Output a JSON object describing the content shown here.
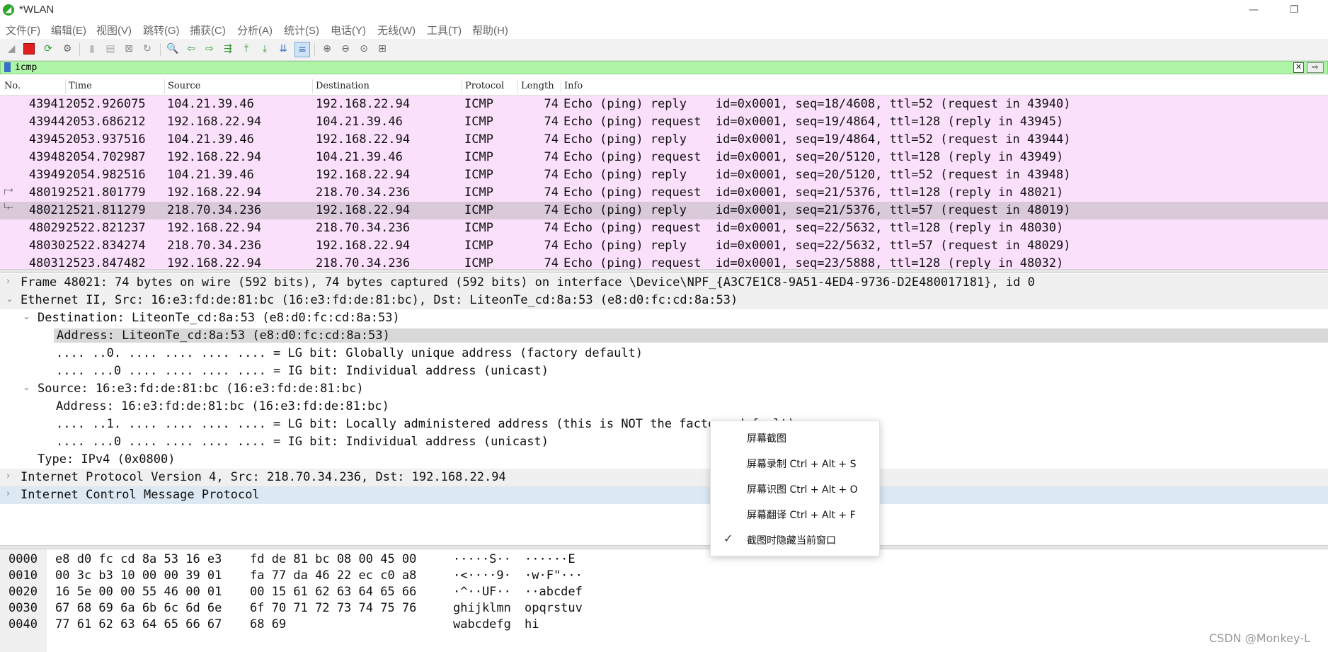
{
  "window": {
    "title": "*WLAN",
    "app_icon": "wireshark-fin-icon"
  },
  "menubar": [
    "文件(F)",
    "编辑(E)",
    "视图(V)",
    "跳转(G)",
    "捕获(C)",
    "分析(A)",
    "统计(S)",
    "电话(Y)",
    "无线(W)",
    "工具(T)",
    "帮助(H)"
  ],
  "filter": {
    "value": "icmp"
  },
  "packet_columns": [
    "No.",
    "Time",
    "Source",
    "Destination",
    "Protocol",
    "Length",
    "Info"
  ],
  "packets": [
    {
      "no": "43941",
      "time": "2052.926075",
      "src": "104.21.39.46",
      "dst": "192.168.22.94",
      "proto": "ICMP",
      "len": "74",
      "info": "Echo (ping) reply    id=0x0001, seq=18/4608, ttl=52 (request in 43940)"
    },
    {
      "no": "43944",
      "time": "2053.686212",
      "src": "192.168.22.94",
      "dst": "104.21.39.46",
      "proto": "ICMP",
      "len": "74",
      "info": "Echo (ping) request  id=0x0001, seq=19/4864, ttl=128 (reply in 43945)"
    },
    {
      "no": "43945",
      "time": "2053.937516",
      "src": "104.21.39.46",
      "dst": "192.168.22.94",
      "proto": "ICMP",
      "len": "74",
      "info": "Echo (ping) reply    id=0x0001, seq=19/4864, ttl=52 (request in 43944)"
    },
    {
      "no": "43948",
      "time": "2054.702987",
      "src": "192.168.22.94",
      "dst": "104.21.39.46",
      "proto": "ICMP",
      "len": "74",
      "info": "Echo (ping) request  id=0x0001, seq=20/5120, ttl=128 (reply in 43949)"
    },
    {
      "no": "43949",
      "time": "2054.982516",
      "src": "104.21.39.46",
      "dst": "192.168.22.94",
      "proto": "ICMP",
      "len": "74",
      "info": "Echo (ping) reply    id=0x0001, seq=20/5120, ttl=52 (request in 43948)"
    },
    {
      "no": "48019",
      "time": "2521.801779",
      "src": "192.168.22.94",
      "dst": "218.70.34.236",
      "proto": "ICMP",
      "len": "74",
      "info": "Echo (ping) request  id=0x0001, seq=21/5376, ttl=128 (reply in 48021)"
    },
    {
      "no": "48021",
      "time": "2521.811279",
      "src": "218.70.34.236",
      "dst": "192.168.22.94",
      "proto": "ICMP",
      "len": "74",
      "info": "Echo (ping) reply    id=0x0001, seq=21/5376, ttl=57 (request in 48019)"
    },
    {
      "no": "48029",
      "time": "2522.821237",
      "src": "192.168.22.94",
      "dst": "218.70.34.236",
      "proto": "ICMP",
      "len": "74",
      "info": "Echo (ping) request  id=0x0001, seq=22/5632, ttl=128 (reply in 48030)"
    },
    {
      "no": "48030",
      "time": "2522.834274",
      "src": "218.70.34.236",
      "dst": "192.168.22.94",
      "proto": "ICMP",
      "len": "74",
      "info": "Echo (ping) reply    id=0x0001, seq=22/5632, ttl=57 (request in 48029)"
    },
    {
      "no": "48031",
      "time": "2523.847482",
      "src": "192.168.22.94",
      "dst": "218.70.34.236",
      "proto": "ICMP",
      "len": "74",
      "info": "Echo (ping) request  id=0x0001, seq=23/5888, ttl=128 (reply in 48032)"
    }
  ],
  "details": [
    "Frame 48021: 74 bytes on wire (592 bits), 74 bytes captured (592 bits) on interface \\Device\\NPF_{A3C7E1C8-9A51-4ED4-9736-D2E480017181}, id 0",
    "Ethernet II, Src: 16:e3:fd:de:81:bc (16:e3:fd:de:81:bc), Dst: LiteonTe_cd:8a:53 (e8:d0:fc:cd:8a:53)",
    "Destination: LiteonTe_cd:8a:53 (e8:d0:fc:cd:8a:53)",
    "Address: LiteonTe_cd:8a:53 (e8:d0:fc:cd:8a:53)",
    ".... ..0. .... .... .... .... = LG bit: Globally unique address (factory default)",
    ".... ...0 .... .... .... .... = IG bit: Individual address (unicast)",
    "Source: 16:e3:fd:de:81:bc (16:e3:fd:de:81:bc)",
    "Address: 16:e3:fd:de:81:bc (16:e3:fd:de:81:bc)",
    ".... ..1. .... .... .... .... = LG bit: Locally administered address (this is NOT the factory default)",
    ".... ...0 .... .... .... .... = IG bit: Individual address (unicast)",
    "Type: IPv4 (0x0800)",
    "Internet Protocol Version 4, Src: 218.70.34.236, Dst: 192.168.22.94",
    "Internet Control Message Protocol"
  ],
  "hex": [
    {
      "off": "0000",
      "b1": "e8 d0 fc cd 8a 53 16 e3",
      "b2": "fd de 81 bc 08 00 45 00",
      "a1": "·····S··",
      "a2": "······E"
    },
    {
      "off": "0010",
      "b1": "00 3c b3 10 00 00 39 01",
      "b2": "fa 77 da 46 22 ec c0 a8",
      "a1": "·<····9·",
      "a2": "·w·F\"···"
    },
    {
      "off": "0020",
      "b1": "16 5e 00 00 55 46 00 01",
      "b2": "00 15 61 62 63 64 65 66",
      "a1": "·^··UF··",
      "a2": "··abcdef"
    },
    {
      "off": "0030",
      "b1": "67 68 69 6a 6b 6c 6d 6e",
      "b2": "6f 70 71 72 73 74 75 76",
      "a1": "ghijklmn",
      "a2": "opqrstuv"
    },
    {
      "off": "0040",
      "b1": "77 61 62 63 64 65 66 67",
      "b2": "68 69",
      "a1": "wabcdefg",
      "a2": "hi"
    }
  ],
  "context_menu": [
    {
      "label": "屏幕截图",
      "checked": false
    },
    {
      "label": "屏幕录制 Ctrl + Alt + S",
      "checked": false
    },
    {
      "label": "屏幕识图 Ctrl + Alt + O",
      "checked": false
    },
    {
      "label": "屏幕翻译 Ctrl + Alt + F",
      "checked": false
    },
    {
      "label": "截图时隐藏当前窗口",
      "checked": true
    }
  ],
  "watermark": "CSDN @Monkey-L",
  "colors": {
    "packet_row_bg": "#fbe0fb",
    "selected_row_bg": "#d9c9d9",
    "filter_bg": "#aff5a8"
  }
}
